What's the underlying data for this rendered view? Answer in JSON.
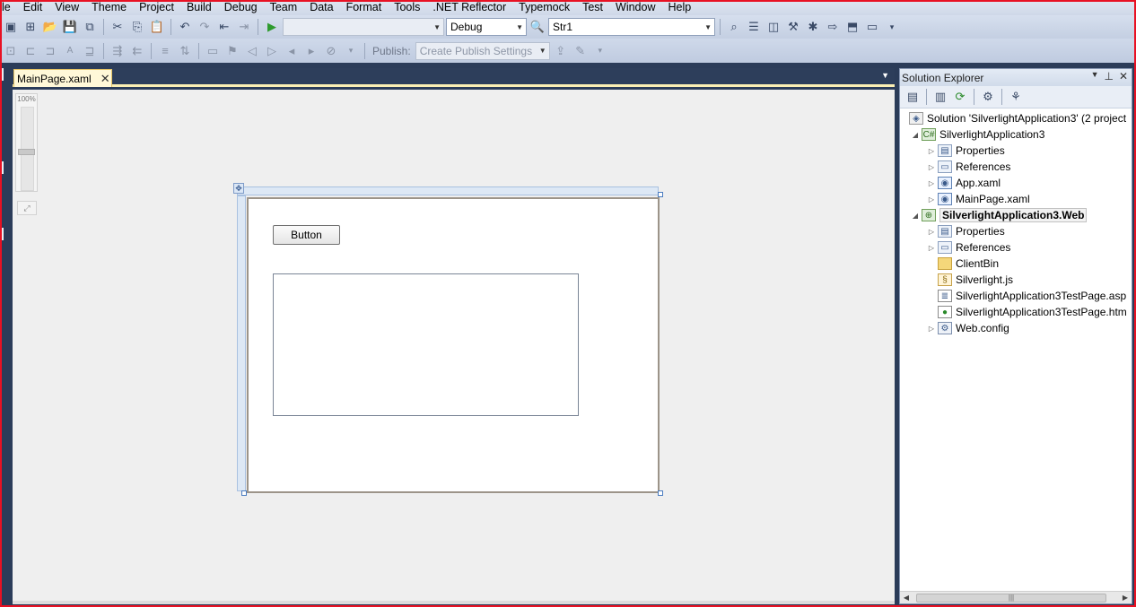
{
  "menu": [
    "le",
    "Edit",
    "View",
    "Theme",
    "Project",
    "Build",
    "Debug",
    "Team",
    "Data",
    "Format",
    "Tools",
    ".NET Reflector",
    "Typemock",
    "Test",
    "Window",
    "Help"
  ],
  "toolbar": {
    "config": "Debug",
    "search": "Str1"
  },
  "toolbar2": {
    "publish_label": "Publish:",
    "publish_settings": "Create Publish Settings"
  },
  "document": {
    "tab_title": "MainPage.xaml",
    "zoom": "100%"
  },
  "designer": {
    "button_label": "Button"
  },
  "solution_explorer": {
    "title": "Solution Explorer",
    "nodes": [
      {
        "label": "Solution 'SilverlightApplication3' (2 project"
      },
      {
        "label": "SilverlightApplication3"
      },
      {
        "label": "Properties"
      },
      {
        "label": "References"
      },
      {
        "label": "App.xaml"
      },
      {
        "label": "MainPage.xaml"
      },
      {
        "label": "SilverlightApplication3.Web"
      },
      {
        "label": "Properties"
      },
      {
        "label": "References"
      },
      {
        "label": "ClientBin"
      },
      {
        "label": "Silverlight.js"
      },
      {
        "label": "SilverlightApplication3TestPage.asp"
      },
      {
        "label": "SilverlightApplication3TestPage.htm"
      },
      {
        "label": "Web.config"
      }
    ]
  },
  "colors": {
    "accent_frame": "#e81123",
    "tab_active": "#fff8d8",
    "chrome_dark": "#2b3c59"
  }
}
